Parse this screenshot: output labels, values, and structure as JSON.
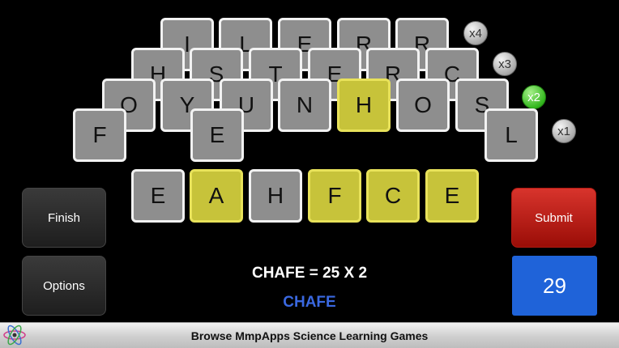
{
  "board": {
    "row4": [
      "I",
      "L",
      "E",
      "R",
      "R"
    ],
    "row3": [
      "H",
      "S",
      "T",
      "E",
      "R",
      "C"
    ],
    "row2": [
      "O",
      "Y",
      "U",
      "N",
      "H",
      "O",
      "S"
    ],
    "row1": [
      "F",
      "E",
      "L"
    ],
    "multipliers": [
      "x4",
      "x3",
      "x2",
      "x1"
    ]
  },
  "answer": {
    "letters": [
      "E",
      "A",
      "H",
      "F",
      "C",
      "E"
    ]
  },
  "buttons": {
    "finish": "Finish",
    "options": "Options",
    "submit": "Submit"
  },
  "score": "29",
  "equation": "CHAFE = 25 X 2",
  "last_word": "CHAFE",
  "banner": {
    "text": "Browse MmpApps Science Learning Games"
  },
  "colors": {
    "highlight": "#c7c33a",
    "tile": "#8e8e8e",
    "score_box": "#1f63d9",
    "submit": "#c0241c",
    "word": "#3a68e0"
  }
}
